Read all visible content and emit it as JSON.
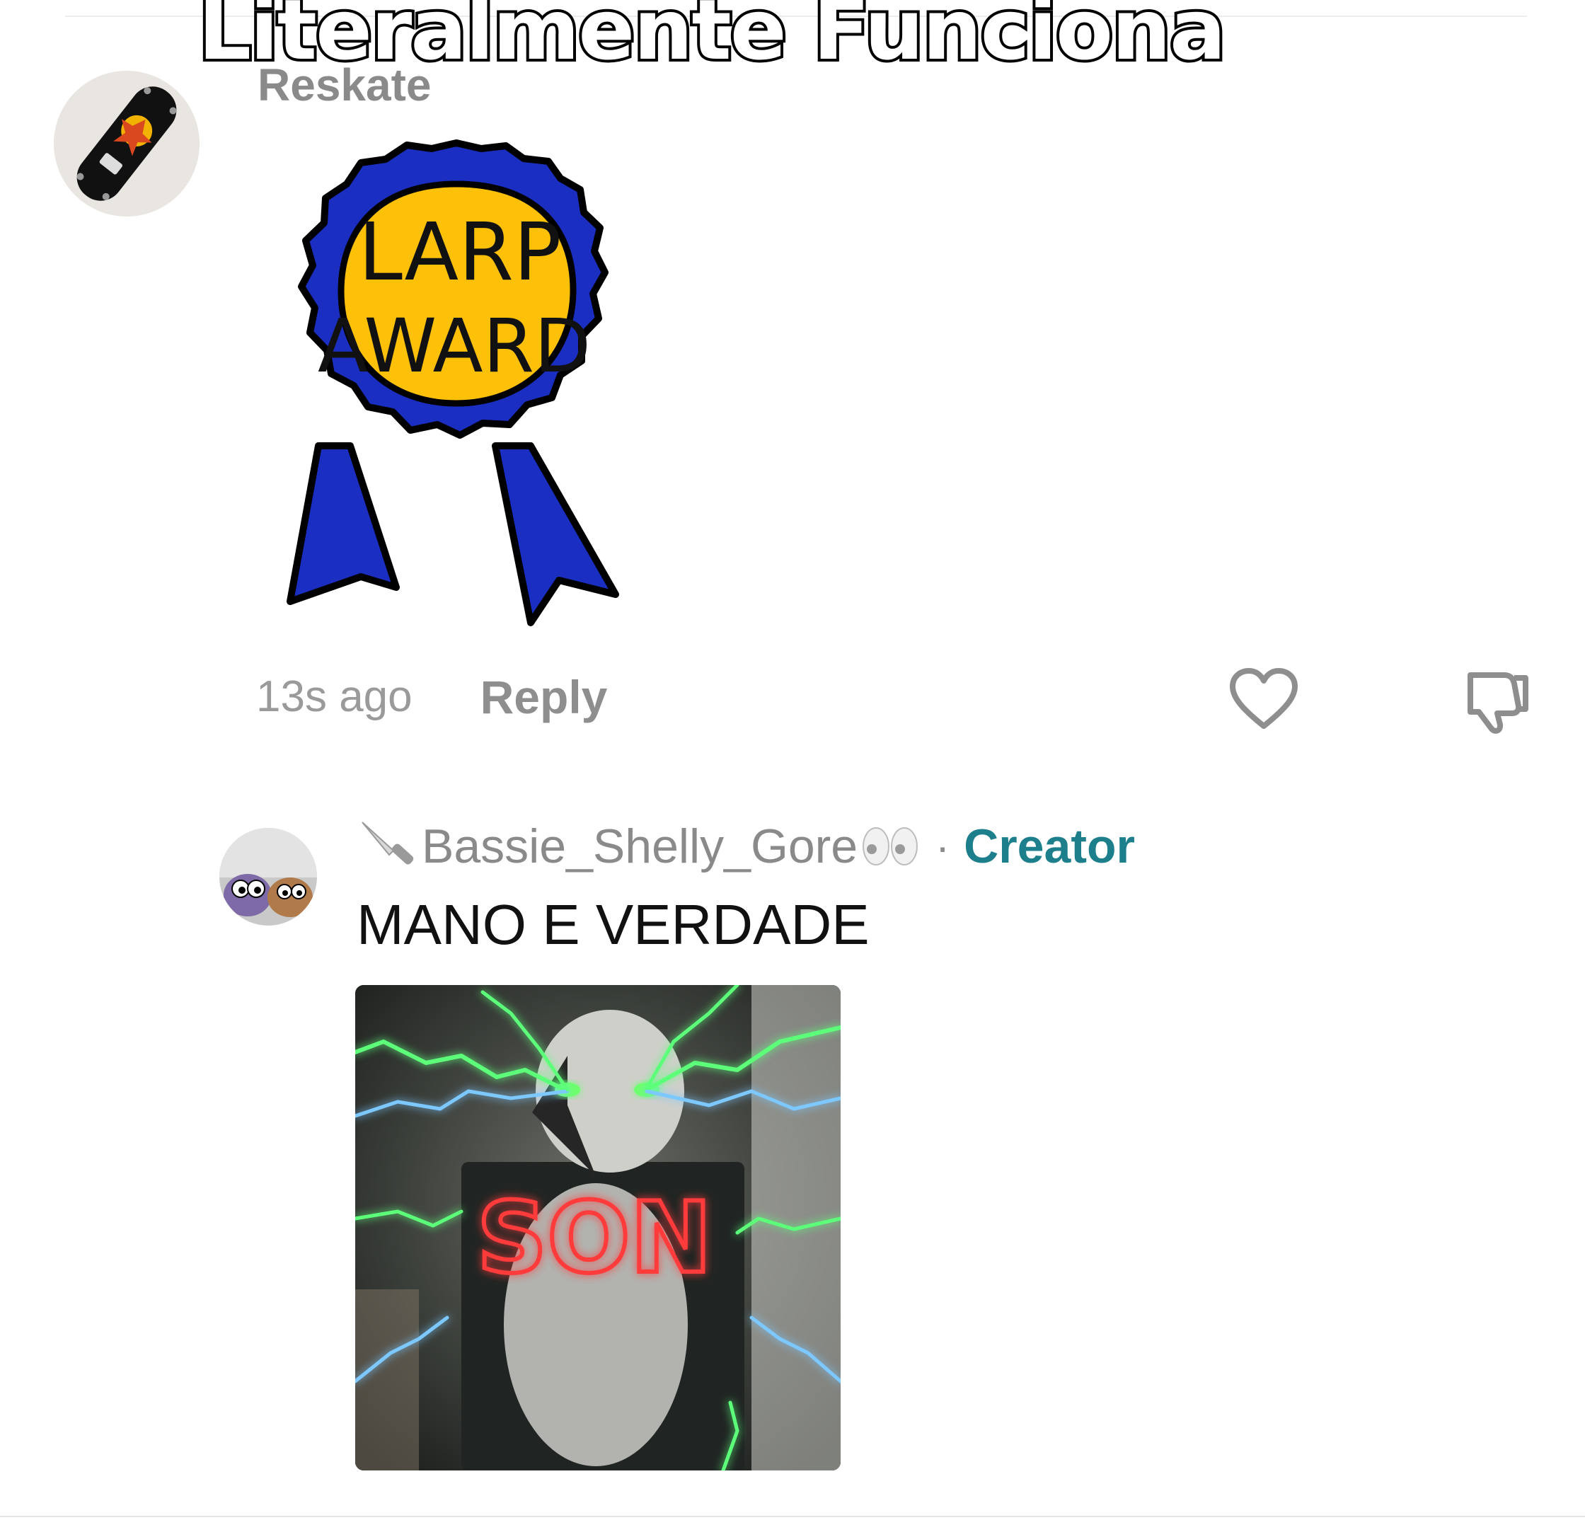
{
  "overlay": {
    "caption": "Literalmente Funciona"
  },
  "comments": [
    {
      "username": "Reskate",
      "avatar_icon": "skateboard-avatar-icon",
      "sticker": {
        "line1": "LARP",
        "line2": "AWARD",
        "colors": {
          "ribbon": "#1a2fc2",
          "medal": "#ffc107"
        }
      },
      "timestamp": "13s ago",
      "reply_label": "Reply",
      "like_icon": "heart-icon",
      "dislike_icon": "thumbs-down-icon"
    },
    {
      "username": "Bassie_Shelly_Gore",
      "prefix_icon": "knife-icon",
      "suffix_icon": "eyes-icon",
      "separator": "·",
      "badge": "Creator",
      "text": "MANO E VERDADE",
      "image": {
        "caption": "SON",
        "icon": "meme-image-lightning"
      }
    }
  ],
  "colors": {
    "creator": "#1d7f8c",
    "muted_text": "#8a8a8a",
    "body_text": "#111111",
    "neon_red": "#ff3a3a",
    "lightning": "#5dff7a"
  }
}
